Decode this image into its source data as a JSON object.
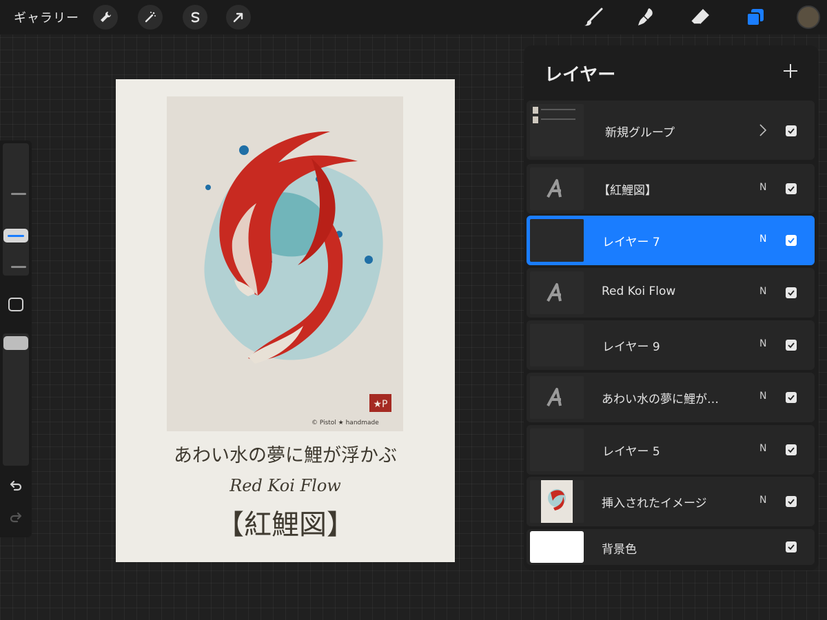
{
  "toolbar": {
    "gallery_label": "ギャラリー",
    "left_tools": [
      "wrench-icon",
      "magic-wand-icon",
      "selection-s-icon",
      "arrow-icon"
    ],
    "right_tools": [
      "brush-icon",
      "smudge-icon",
      "eraser-icon",
      "layers-icon"
    ],
    "active_color": "#5a5040",
    "accent": "#1a7dff"
  },
  "sidebar": {
    "items": [
      "brush-size-slider",
      "modify-button",
      "opacity-slider",
      "undo-icon",
      "redo-icon"
    ]
  },
  "canvas": {
    "caption_jp": "あわい水の夢に鯉が浮かぶ",
    "caption_en": "Red Koi Flow",
    "caption_title": "【紅鯉図】",
    "signature": "© Pistol ★ handmade",
    "stamp": "★P"
  },
  "layers_panel": {
    "title": "レイヤー",
    "add_label": "+",
    "layers": [
      {
        "name": "新規グループ",
        "blend": "",
        "type": "group",
        "visible": true,
        "selected": false
      },
      {
        "name": "【紅鯉図】",
        "blend": "N",
        "type": "text",
        "visible": true,
        "selected": false
      },
      {
        "name": "レイヤー 7",
        "blend": "N",
        "type": "empty",
        "visible": true,
        "selected": true
      },
      {
        "name": "Red Koi Flow",
        "blend": "N",
        "type": "text",
        "visible": true,
        "selected": false
      },
      {
        "name": "レイヤー 9",
        "blend": "N",
        "type": "empty",
        "visible": true,
        "selected": false
      },
      {
        "name": "あわい水の夢に鯉が…",
        "blend": "N",
        "type": "text",
        "visible": true,
        "selected": false
      },
      {
        "name": "レイヤー 5",
        "blend": "N",
        "type": "empty",
        "visible": true,
        "selected": false
      },
      {
        "name": "挿入されたイメージ",
        "blend": "N",
        "type": "image",
        "visible": true,
        "selected": false
      },
      {
        "name": "背景色",
        "blend": "",
        "type": "background",
        "visible": true,
        "selected": false
      }
    ]
  }
}
